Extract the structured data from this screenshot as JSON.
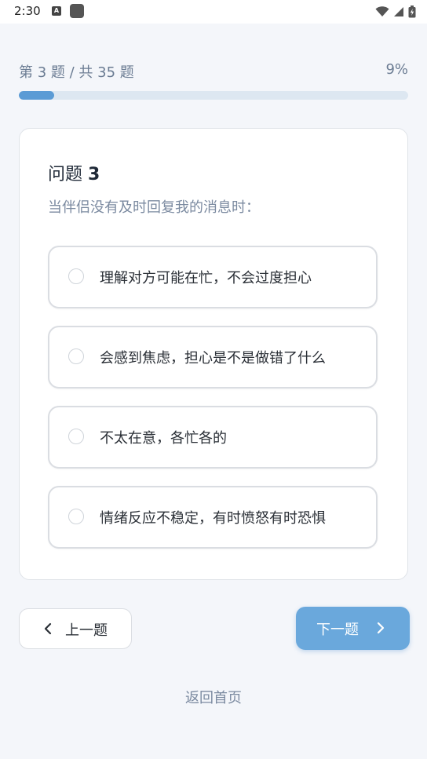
{
  "status_bar": {
    "time": "2:30",
    "icons": [
      "a-notification-icon",
      "app-notification-icon",
      "wifi-icon",
      "signal-icon",
      "battery-icon"
    ]
  },
  "progress": {
    "label": "第 3 题 / 共 35 题",
    "percent_text": "9%",
    "fraction": 0.09
  },
  "question": {
    "title_prefix": "问题",
    "title_number": "3",
    "text": "当伴侣没有及时回复我的消息时："
  },
  "options": [
    {
      "label": "理解对方可能在忙，不会过度担心",
      "selected": false
    },
    {
      "label": "会感到焦虑，担心是不是做错了什么",
      "selected": false
    },
    {
      "label": "不太在意，各忙各的",
      "selected": false
    },
    {
      "label": "情绪反应不稳定，有时愤怒有时恐惧",
      "selected": false
    }
  ],
  "navigation": {
    "prev_label": "上一题",
    "next_label": "下一题",
    "home_label": "返回首页"
  },
  "colors": {
    "accent": "#5b9bd5",
    "next_button": "#6aa8dc",
    "track": "#dde7f1",
    "muted_text": "#7b8aa0"
  }
}
